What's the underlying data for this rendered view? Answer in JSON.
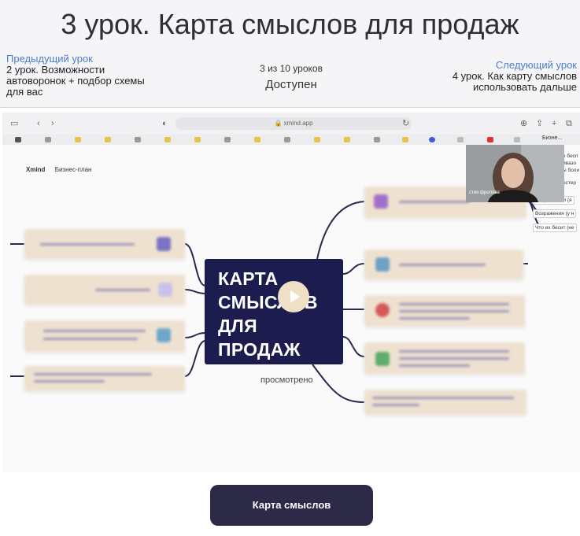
{
  "lesson": {
    "title": "3 урок. Карта смыслов для продаж",
    "previous": {
      "label": "Предыдущий урок",
      "name": "2 урок. Возможности автоворонок + подбор схемы для вас"
    },
    "progress": {
      "count": "3 из 10 уроков",
      "status": "Доступен"
    },
    "next": {
      "label": "Следующий урок",
      "name": "4 урок. Как карту смыслов использовать дальше"
    }
  },
  "video": {
    "browser_url": "xmind.app",
    "xmind": {
      "app": "Xmind",
      "doc": "Бизнес-план"
    },
    "browser_tab": "Бизне...",
    "center_title": "КАРТА СМЫСЛОВ ДЛЯ ПРОДАЖ",
    "viewed_label": "просмотрено",
    "camera_caption": "стия фролова",
    "side_labels": [
      "Потребности (я",
      "Возражения (у н",
      "Что их бесит (не"
    ],
    "side_partial": [
      "е бесп",
      "ивазо",
      "ы боли",
      "остер"
    ]
  },
  "cta": {
    "label": "Карта смыслов"
  },
  "colors": {
    "accent": "#2c2a47",
    "link": "#4a7ec9",
    "center_node": "#1c1c4e",
    "branch_node": "#efe1d0"
  }
}
